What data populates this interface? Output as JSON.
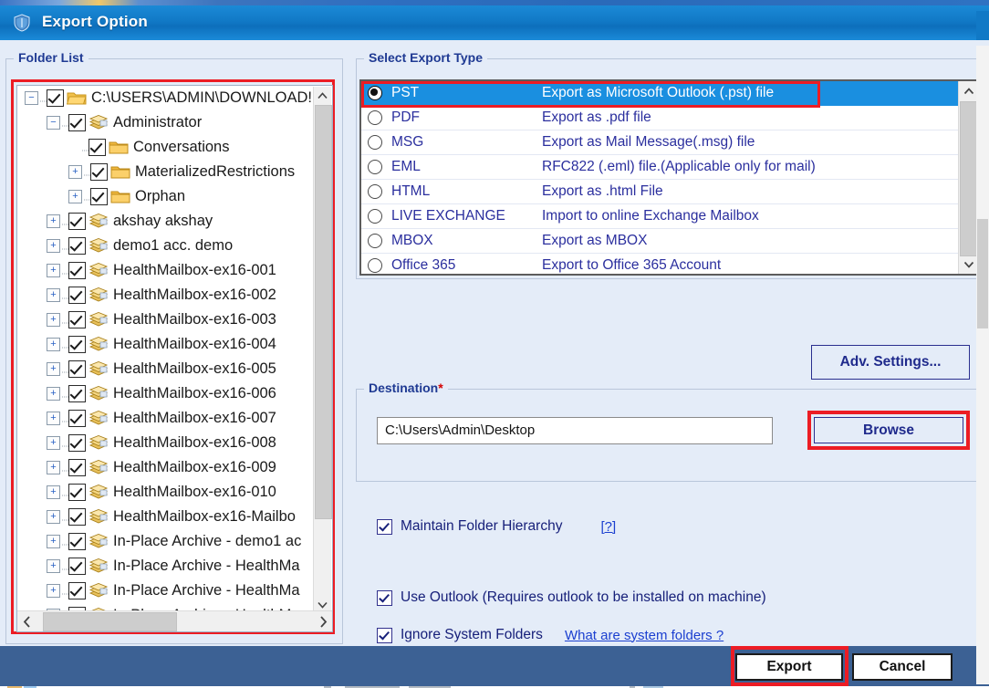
{
  "window": {
    "title": "Export Option",
    "app_icon": "shield-app-icon"
  },
  "folder_list": {
    "legend": "Folder List",
    "hscroll_left_icon": "chevron-left-icon",
    "hscroll_right_icon": "chevron-right-icon",
    "vscroll_up_icon": "chevron-up-icon",
    "vscroll_down_icon": "chevron-down-icon",
    "nodes": [
      {
        "label": "C:\\USERS\\ADMIN\\DOWNLOAD!",
        "depth": 0,
        "checked": true,
        "expander": "minus",
        "icon": "folder-open-icon"
      },
      {
        "label": "Administrator",
        "depth": 1,
        "checked": true,
        "expander": "minus",
        "icon": "mailbox-icon"
      },
      {
        "label": "Conversations",
        "depth": 2,
        "checked": true,
        "expander": "none",
        "icon": "folder-icon"
      },
      {
        "label": "MaterializedRestrictions",
        "depth": 2,
        "checked": true,
        "expander": "plus",
        "icon": "folder-icon"
      },
      {
        "label": "Orphan",
        "depth": 2,
        "checked": true,
        "expander": "plus",
        "icon": "folder-icon"
      },
      {
        "label": "akshay akshay",
        "depth": 1,
        "checked": true,
        "expander": "plus",
        "icon": "mailbox-icon"
      },
      {
        "label": "demo1 acc. demo",
        "depth": 1,
        "checked": true,
        "expander": "plus",
        "icon": "mailbox-icon"
      },
      {
        "label": "HealthMailbox-ex16-001",
        "depth": 1,
        "checked": true,
        "expander": "plus",
        "icon": "mailbox-icon"
      },
      {
        "label": "HealthMailbox-ex16-002",
        "depth": 1,
        "checked": true,
        "expander": "plus",
        "icon": "mailbox-icon"
      },
      {
        "label": "HealthMailbox-ex16-003",
        "depth": 1,
        "checked": true,
        "expander": "plus",
        "icon": "mailbox-icon"
      },
      {
        "label": "HealthMailbox-ex16-004",
        "depth": 1,
        "checked": true,
        "expander": "plus",
        "icon": "mailbox-icon"
      },
      {
        "label": "HealthMailbox-ex16-005",
        "depth": 1,
        "checked": true,
        "expander": "plus",
        "icon": "mailbox-icon"
      },
      {
        "label": "HealthMailbox-ex16-006",
        "depth": 1,
        "checked": true,
        "expander": "plus",
        "icon": "mailbox-icon"
      },
      {
        "label": "HealthMailbox-ex16-007",
        "depth": 1,
        "checked": true,
        "expander": "plus",
        "icon": "mailbox-icon"
      },
      {
        "label": "HealthMailbox-ex16-008",
        "depth": 1,
        "checked": true,
        "expander": "plus",
        "icon": "mailbox-icon"
      },
      {
        "label": "HealthMailbox-ex16-009",
        "depth": 1,
        "checked": true,
        "expander": "plus",
        "icon": "mailbox-icon"
      },
      {
        "label": "HealthMailbox-ex16-010",
        "depth": 1,
        "checked": true,
        "expander": "plus",
        "icon": "mailbox-icon"
      },
      {
        "label": "HealthMailbox-ex16-Mailbo",
        "depth": 1,
        "checked": true,
        "expander": "plus",
        "icon": "mailbox-icon"
      },
      {
        "label": "In-Place Archive - demo1 ac",
        "depth": 1,
        "checked": true,
        "expander": "plus",
        "icon": "mailbox-icon"
      },
      {
        "label": "In-Place Archive - HealthMa",
        "depth": 1,
        "checked": true,
        "expander": "plus",
        "icon": "mailbox-icon"
      },
      {
        "label": "In-Place Archive - HealthMa",
        "depth": 1,
        "checked": true,
        "expander": "plus",
        "icon": "mailbox-icon"
      },
      {
        "label": "In-Place Archive - HealthMa",
        "depth": 1,
        "checked": true,
        "expander": "plus",
        "icon": "mailbox-icon"
      }
    ]
  },
  "export_type": {
    "legend": "Select Export Type",
    "selected": "PST",
    "vscroll_up_icon": "chevron-up-icon",
    "vscroll_down_icon": "chevron-down-icon",
    "rows": [
      {
        "name": "PST",
        "desc": "Export as Microsoft Outlook (.pst) file",
        "selected": true
      },
      {
        "name": "PDF",
        "desc": "Export as .pdf file",
        "selected": false
      },
      {
        "name": "MSG",
        "desc": "Export as Mail Message(.msg) file",
        "selected": false
      },
      {
        "name": "EML",
        "desc": "RFC822 (.eml) file.(Applicable only for mail)",
        "selected": false
      },
      {
        "name": "HTML",
        "desc": "Export as .html File",
        "selected": false
      },
      {
        "name": "LIVE EXCHANGE",
        "desc": "Import to online Exchange Mailbox",
        "selected": false
      },
      {
        "name": "MBOX",
        "desc": "Export as MBOX",
        "selected": false
      },
      {
        "name": "Office 365",
        "desc": "Export to Office 365 Account",
        "selected": false
      }
    ]
  },
  "adv_settings": {
    "label": "Adv. Settings..."
  },
  "destination": {
    "legend": "Destination",
    "required_mark": "*",
    "path_value": "C:\\Users\\Admin\\Desktop",
    "browse_label": "Browse"
  },
  "options": {
    "maintain_hierarchy": {
      "label": "Maintain Folder Hierarchy",
      "checked": true,
      "help_link": "[?]"
    },
    "use_outlook": {
      "label": "Use Outlook (Requires outlook to be installed on machine)",
      "checked": true
    },
    "ignore_system": {
      "label": "Ignore System Folders",
      "checked": true,
      "help_link": "What are system folders ?"
    }
  },
  "footer": {
    "export_label": "Export",
    "cancel_label": "Cancel"
  },
  "colors": {
    "title_blue": "#1179c6",
    "dialog_bg": "#e4ecf8",
    "highlight_red": "#ec1c24",
    "selection_blue": "#1a8fe0",
    "label_blue": "#1f3a93",
    "footer_blue": "#3c6194"
  }
}
